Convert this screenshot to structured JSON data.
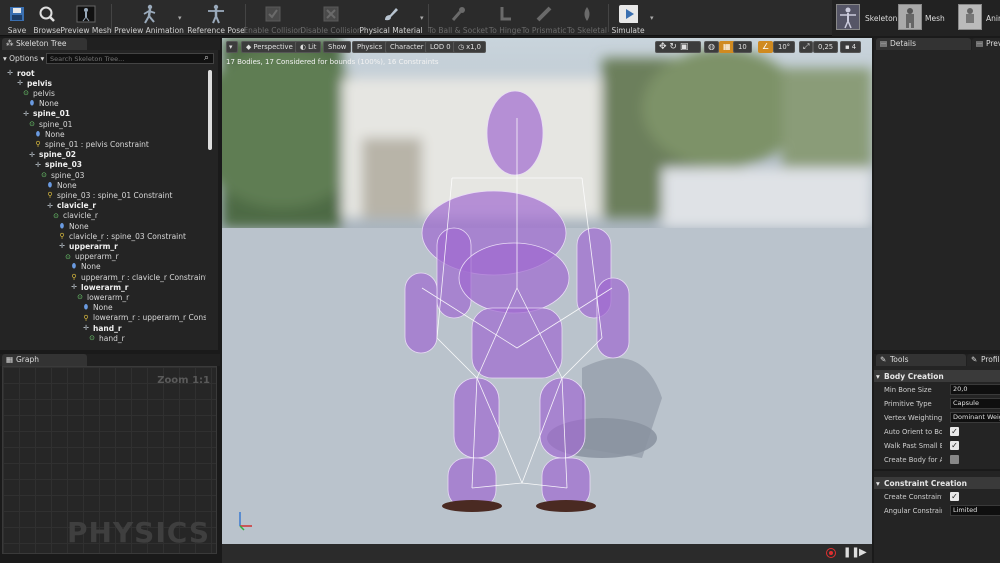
{
  "toolbar": {
    "save": "Save",
    "browse": "Browse",
    "preview_mesh": "Preview Mesh",
    "preview_animation": "Preview Animation",
    "reference_pose": "Reference Pose",
    "enable_collision": "Enable Collision",
    "disable_collision": "Disable Collision",
    "physical_material": "Physical Material",
    "to_ball_socket": "To Ball & Socket",
    "to_hinge": "To Hinge",
    "to_prismatic": "To Prismatic",
    "to_skeletal": "To Skeletal",
    "simulate": "Simulate",
    "mode_skeleton": "Skeleton",
    "mode_mesh": "Mesh",
    "mode_anim": "Anim"
  },
  "skeleton_tree": {
    "tab": "Skeleton Tree",
    "options": "Options",
    "search_placeholder": "Search Skeleton Tree...",
    "rows": [
      {
        "label": "root",
        "type": "bone",
        "bold": true
      },
      {
        "label": "pelvis",
        "type": "bone",
        "bold": true
      },
      {
        "label": "pelvis",
        "type": "body"
      },
      {
        "label": "None",
        "type": "shape"
      },
      {
        "label": "spine_01",
        "type": "bone",
        "bold": true
      },
      {
        "label": "spine_01",
        "type": "body"
      },
      {
        "label": "None",
        "type": "shape"
      },
      {
        "label": "spine_01 : pelvis Constraint",
        "type": "constraint"
      },
      {
        "label": "spine_02",
        "type": "bone",
        "bold": true
      },
      {
        "label": "spine_03",
        "type": "bone",
        "bold": true
      },
      {
        "label": "spine_03",
        "type": "body"
      },
      {
        "label": "None",
        "type": "shape"
      },
      {
        "label": "spine_03 : spine_01 Constraint",
        "type": "constraint"
      },
      {
        "label": "clavicle_r",
        "type": "bone",
        "bold": true
      },
      {
        "label": "clavicle_r",
        "type": "body"
      },
      {
        "label": "None",
        "type": "shape"
      },
      {
        "label": "clavicle_r : spine_03 Constraint",
        "type": "constraint"
      },
      {
        "label": "upperarm_r",
        "type": "bone",
        "bold": true
      },
      {
        "label": "upperarm_r",
        "type": "body"
      },
      {
        "label": "None",
        "type": "shape"
      },
      {
        "label": "upperarm_r : clavicle_r Constraint",
        "type": "constraint"
      },
      {
        "label": "lowerarm_r",
        "type": "bone",
        "bold": true
      },
      {
        "label": "lowerarm_r",
        "type": "body"
      },
      {
        "label": "None",
        "type": "shape"
      },
      {
        "label": "lowerarm_r : upperarm_r Constraint",
        "type": "constraint"
      },
      {
        "label": "hand_r",
        "type": "bone",
        "bold": true
      },
      {
        "label": "hand_r",
        "type": "body"
      }
    ]
  },
  "graph": {
    "tab": "Graph",
    "zoom": "Zoom 1:1",
    "watermark": "PHYSICS"
  },
  "viewport": {
    "perspective": "Perspective",
    "lit": "Lit",
    "show": "Show",
    "physics": "Physics",
    "character": "Character",
    "lod": "LOD 0",
    "speed": "x1,0",
    "grid": "10",
    "rot": "10°",
    "scale": "0,25",
    "cam": "4",
    "stats": "17 Bodies, 17 Considered for bounds (100%), 16 Constraints"
  },
  "details": {
    "tab": "Details",
    "tab2": "Preview"
  },
  "tools": {
    "tab": "Tools",
    "tab2": "Profile",
    "body_creation": "Body Creation",
    "min_bone_size_label": "Min Bone Size",
    "min_bone_size": "20,0",
    "primitive_type_label": "Primitive Type",
    "primitive_type": "Capsule",
    "vertex_weighting_label": "Vertex Weighting Type",
    "vertex_weighting": "Dominant Weight",
    "auto_orient_label": "Auto Orient to Bone",
    "auto_orient": true,
    "walk_past_label": "Walk Past Small Bones",
    "walk_past": true,
    "create_all_label": "Create Body for All Bones",
    "create_all": false,
    "constraint_creation": "Constraint Creation",
    "create_constraints_label": "Create Constraints",
    "create_constraints": true,
    "angular_mode_label": "Angular Constraint Mode",
    "angular_mode": "Limited"
  },
  "colors": {
    "accent": "#d08a20",
    "body": "#a06ad0",
    "record": "#e03030"
  }
}
